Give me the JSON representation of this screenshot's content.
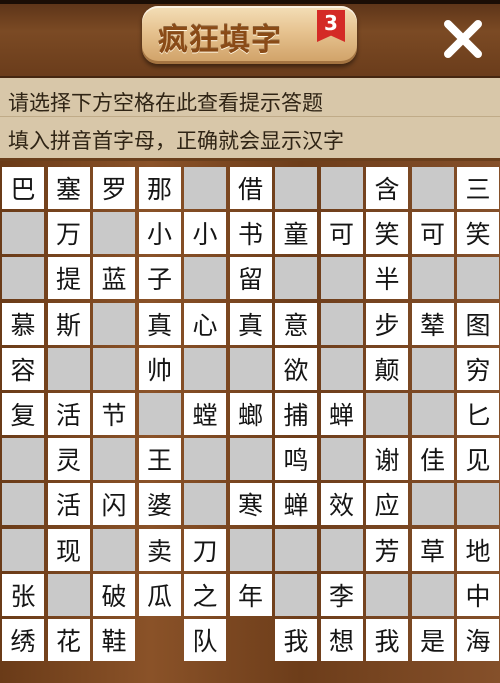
{
  "header": {
    "title": "疯狂填字",
    "level": "3",
    "close_icon": "close-x-icon"
  },
  "hints": {
    "line1": "请选择下方空格在此查看提示答题",
    "line2": "填入拼音首字母，正确就会显示汉字"
  },
  "colors": {
    "cell_filled": "#ffffff",
    "cell_empty": "#c9c9c9",
    "wood": "#7a4621",
    "badge": "#d42a26",
    "title_text": "#8a4b17"
  },
  "board": {
    "legend": "# = empty input cell, . = no cell (wood background)",
    "rows": [
      [
        "巴",
        "塞",
        "罗",
        "那",
        "#",
        "借",
        "#",
        "#",
        "含",
        "#",
        "三"
      ],
      [
        "#",
        "万",
        "#",
        "小",
        "小",
        "书",
        "童",
        "可",
        "笑",
        "可",
        "笑"
      ],
      [
        "#",
        "提",
        "蓝",
        "子",
        "#",
        "留",
        "#",
        "#",
        "半",
        "#",
        "#"
      ],
      [
        "慕",
        "斯",
        "#",
        "真",
        "心",
        "真",
        "意",
        "#",
        "步",
        "辇",
        "图"
      ],
      [
        "容",
        "#",
        "#",
        "帅",
        "#",
        "#",
        "欲",
        "#",
        "颠",
        "#",
        "穷"
      ],
      [
        "复",
        "活",
        "节",
        "#",
        "螳",
        "螂",
        "捕",
        "蝉",
        "#",
        "#",
        "匕"
      ],
      [
        "#",
        "灵",
        "#",
        "王",
        "#",
        "#",
        "鸣",
        "#",
        "谢",
        "佳",
        "见"
      ],
      [
        "#",
        "活",
        "闪",
        "婆",
        "#",
        "寒",
        "蝉",
        "效",
        "应",
        "#",
        "#"
      ],
      [
        "#",
        "现",
        "#",
        "卖",
        "刀",
        "#",
        "#",
        "#",
        "芳",
        "草",
        "地"
      ],
      [
        "张",
        "#",
        "破",
        "瓜",
        "之",
        "年",
        "#",
        "李",
        "#",
        "#",
        "中"
      ],
      [
        "绣",
        "花",
        "鞋",
        ".",
        "队",
        ".",
        "我",
        "想",
        "我",
        "是",
        "海"
      ]
    ]
  }
}
